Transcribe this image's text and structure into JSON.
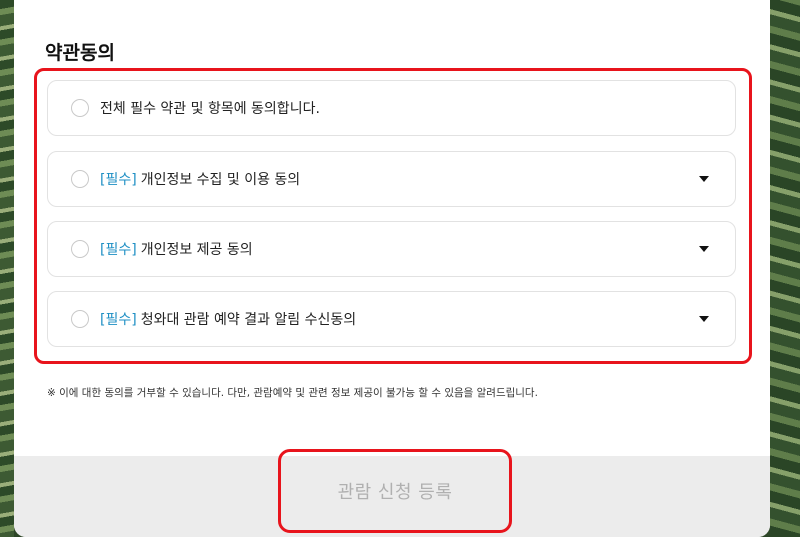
{
  "terms": {
    "title": "약관동의",
    "all_agree_label": "전체 필수 약관 및 항목에 동의합니다.",
    "items": [
      {
        "tag": "[필수]",
        "label": "개인정보 수집 및 이용 동의"
      },
      {
        "tag": "[필수]",
        "label": "개인정보 제공 동의"
      },
      {
        "tag": "[필수]",
        "label": "청와대 관람 예약 결과 알림 수신동의"
      }
    ],
    "notice": "※ 이에 대한 동의를 거부할 수 있습니다. 다만, 관람예약 및 관련 정보 제공이 불가능 할 수 있음을 알려드립니다."
  },
  "footer": {
    "submit_label": "관람 신청 등록"
  },
  "colors": {
    "highlight": "#e8141c",
    "required_tag": "#1e8fc4",
    "footer_bg": "#ececec",
    "disabled_text": "#b0b0b0"
  }
}
